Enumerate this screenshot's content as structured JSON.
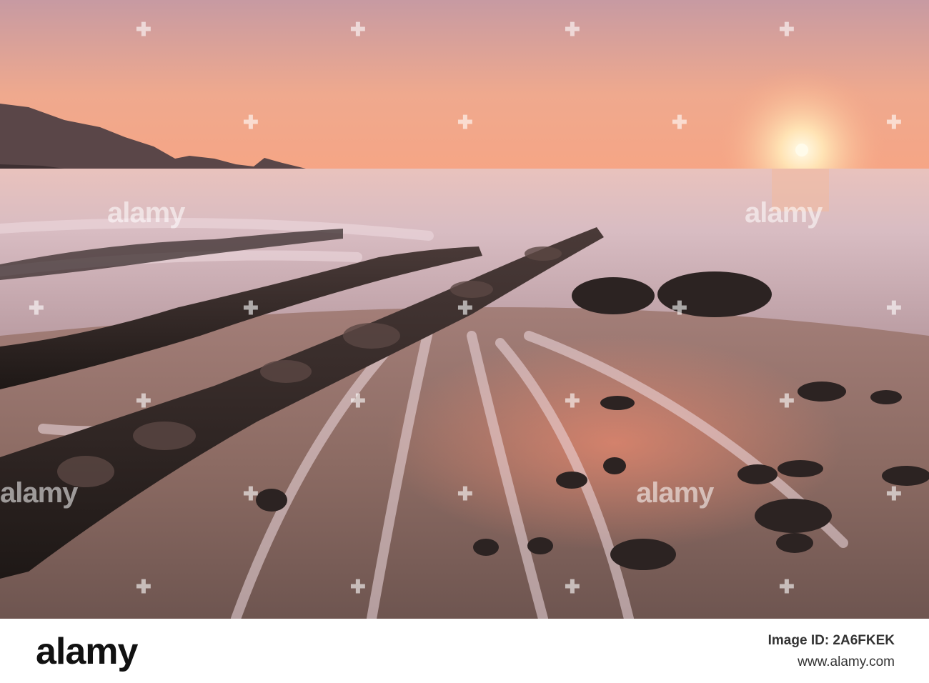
{
  "watermark": {
    "text": "alamy"
  },
  "footer": {
    "logo": "alamy",
    "image_id_line": "Image ID: 2A6FKEK",
    "site": "www.alamy.com"
  },
  "colors": {
    "sky_top": "#c99aa0",
    "sky_horizon": "#f4a584",
    "sun": "#fff4d6",
    "rock": "#2a2220",
    "water_mist": "#e4c6c8",
    "sand": "#8c6b5f"
  }
}
